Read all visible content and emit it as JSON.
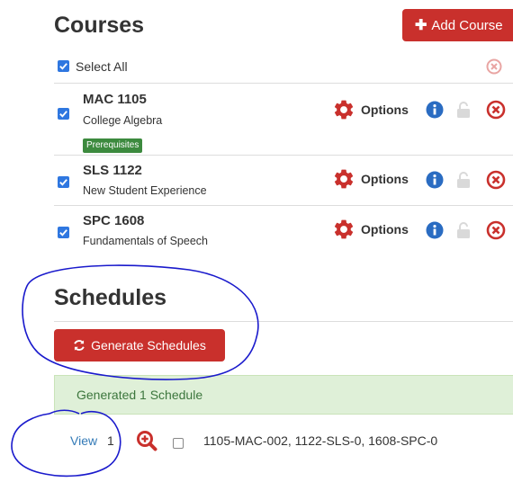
{
  "courses": {
    "heading": "Courses",
    "add_button_label": "Add Course",
    "select_all_label": "Select All",
    "options_label": "Options",
    "items": [
      {
        "code": "MAC 1105",
        "title": "College Algebra",
        "badge": "Prerequisites",
        "checked": true
      },
      {
        "code": "SLS 1122",
        "title": "New Student Experience",
        "checked": true
      },
      {
        "code": "SPC 1608",
        "title": "Fundamentals of Speech",
        "checked": true
      }
    ]
  },
  "schedules": {
    "heading": "Schedules",
    "generate_button_label": "Generate Schedules",
    "alert_text": "Generated 1 Schedule",
    "rows": [
      {
        "view_label": "View",
        "number": "1",
        "sections": "1105-MAC-002, 1122-SLS-0, 1608-SPC-0",
        "checked": false
      }
    ]
  },
  "colors": {
    "danger": "#c9302c",
    "primary": "#2f77e0",
    "success_bg": "#dff0d8",
    "success_text": "#3c763d",
    "ink_annotation": "#1a1acc"
  },
  "icons": [
    "plus-icon",
    "gear-icon",
    "info-icon",
    "lock-icon",
    "remove-circle-icon",
    "refresh-icon",
    "zoom-in-icon"
  ]
}
